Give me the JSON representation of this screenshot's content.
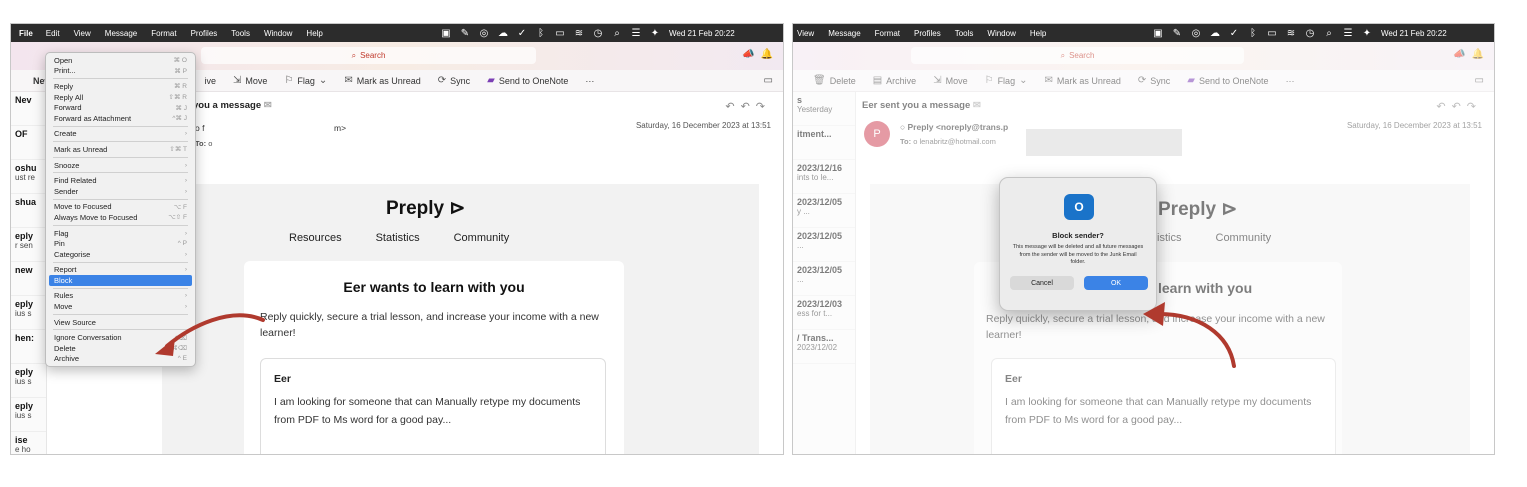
{
  "menubar": {
    "left_items": [
      "File",
      "Edit",
      "View",
      "Message",
      "Format",
      "Profiles",
      "Tools",
      "Window",
      "Help"
    ],
    "right_items": [
      "View",
      "Message",
      "Format",
      "Profiles",
      "Tools",
      "Window",
      "Help"
    ],
    "clock": "Wed 21 Feb 20:22"
  },
  "search": {
    "label": "Search"
  },
  "toolbar": {
    "new_label": "New",
    "delete": "Delete",
    "archive_partial": "ive",
    "archive": "Archive",
    "move": "Move",
    "flag": "Flag",
    "mark_unread": "Mark as Unread",
    "sync": "Sync",
    "onenote": "Send to OneNote",
    "more": "···"
  },
  "message": {
    "subject_partial": "you a message",
    "subject": "Eer sent you a message",
    "sender_partial_left": "o f",
    "sender_partial_right": "m>",
    "sender_name": "Preply <noreply@trans.p",
    "to_label": "To:",
    "to_left": "o",
    "to_right": "o lenabritz@hotmail.com",
    "date": "Saturday, 16 December 2023 at 13:51",
    "avatar": "P"
  },
  "email": {
    "brand": "Preply",
    "nav": [
      "Resources",
      "Statistics",
      "Community"
    ],
    "nav_partial": [
      "tistics",
      "Community"
    ],
    "heading": "Eer wants to learn with you",
    "heading_partial": "learn with you",
    "body": "Reply quickly, secure a trial lesson, and increase your income with a new learner!",
    "quote_name": "Eer",
    "quote_text": "I am looking for someone that can Manually retype my documents from PDF to Ms word for a good pay..."
  },
  "left_list": [
    {
      "t": "Nev",
      "s": ""
    },
    {
      "t": "OF",
      "s": ""
    },
    {
      "t": "oshu",
      "s": "ust re"
    },
    {
      "t": "shua",
      "s": ""
    },
    {
      "t": "eply",
      "s": "r sen"
    },
    {
      "t": "new",
      "s": ""
    },
    {
      "t": "eply",
      "s": "ius s"
    },
    {
      "t": "hen:",
      "s": ""
    },
    {
      "t": "eply",
      "s": "ius s"
    },
    {
      "t": "eply",
      "s": "ius s"
    },
    {
      "t": "ise",
      "s": "e ho"
    }
  ],
  "right_list": [
    {
      "t": "s",
      "s": "Yesterday"
    },
    {
      "t": "itment...",
      "s": ""
    },
    {
      "t": "2023/12/16",
      "s": "ints to le..."
    },
    {
      "t": "2023/12/05",
      "s": "y ..."
    },
    {
      "t": "2023/12/05",
      "s": "..."
    },
    {
      "t": "2023/12/05",
      "s": "..."
    },
    {
      "t": "2023/12/03",
      "s": "ess for t..."
    },
    {
      "t": "/ Trans...",
      "s": "2023/12/02"
    }
  ],
  "context_menu": [
    {
      "label": "Open",
      "sc": "⌘ O"
    },
    {
      "label": "Print...",
      "sc": "⌘ P"
    },
    {
      "sep": true
    },
    {
      "label": "Reply",
      "sc": "⌘ R"
    },
    {
      "label": "Reply All",
      "sc": "⇧⌘ R"
    },
    {
      "label": "Forward",
      "sc": "⌘ J"
    },
    {
      "label": "Forward as Attachment",
      "sc": "^⌘ J"
    },
    {
      "sep": true
    },
    {
      "label": "Create",
      "sc": "›"
    },
    {
      "sep": true
    },
    {
      "label": "Mark as Unread",
      "sc": "⇧⌘ T"
    },
    {
      "sep": true
    },
    {
      "label": "Snooze",
      "sc": "›"
    },
    {
      "sep": true
    },
    {
      "label": "Find Related",
      "sc": "›"
    },
    {
      "label": "Sender",
      "sc": "›"
    },
    {
      "sep": true
    },
    {
      "label": "Move to Focused",
      "sc": "⌥ F"
    },
    {
      "label": "Always Move to Focused",
      "sc": "⌥⇧ F"
    },
    {
      "sep": true
    },
    {
      "label": "Flag",
      "sc": "›"
    },
    {
      "label": "Pin",
      "sc": "^ P"
    },
    {
      "label": "Categorise",
      "sc": "›"
    },
    {
      "sep": true
    },
    {
      "label": "Report",
      "sc": "›"
    },
    {
      "label": "Block",
      "sc": "",
      "highlight": true
    },
    {
      "sep": true
    },
    {
      "label": "Rules",
      "sc": "›"
    },
    {
      "label": "Move",
      "sc": "›"
    },
    {
      "sep": true
    },
    {
      "label": "View Source",
      "sc": ""
    },
    {
      "sep": true
    },
    {
      "label": "Ignore Conversation",
      "sc": "^⌫"
    },
    {
      "label": "Delete",
      "sc": "⌘⌫"
    },
    {
      "label": "Archive",
      "sc": "^ E"
    }
  ],
  "dialog": {
    "icon": "O",
    "title": "Block sender?",
    "message": "This message will be deleted and all future messages from the sender will be moved to the Junk Email folder.",
    "cancel": "Cancel",
    "ok": "OK"
  },
  "colors": {
    "accent": "#3b83e6",
    "arrow": "#b03a2e",
    "avatar": "#d0485a"
  }
}
